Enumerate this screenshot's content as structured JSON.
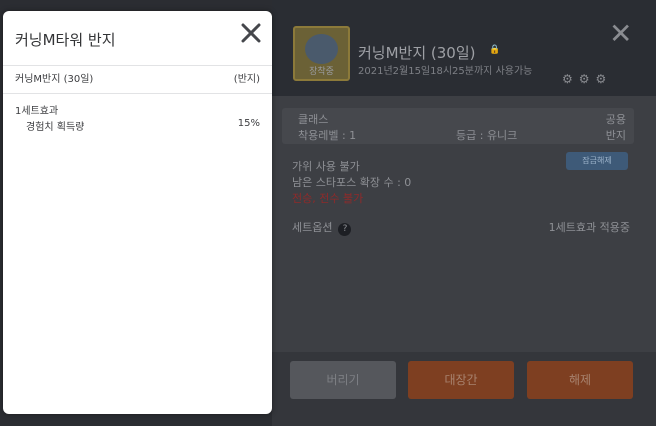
{
  "modal": {
    "title": "커닝M타워 반지",
    "item_name": "커닝M반지 (30일)",
    "item_type": "(반지)",
    "set_label": "1세트효과",
    "stat_name": "경험치 획득량",
    "stat_value": "15%"
  },
  "detail": {
    "thumb_badge": "장착중",
    "title": "커닝M반지 (30일)",
    "lock_icon": "lock-icon",
    "expiry": "2021년2월15일18시25분까지 사용가능",
    "class_label": "클래스",
    "class_value": "공용",
    "req_level": "착용레벨 : 1",
    "grade": "등급 : 유니크",
    "slot": "반지",
    "scissors": "가위 사용 불가",
    "starforce": "남은 스타포스 확장 수 : 0",
    "restriction": "전승, 전수 불가",
    "unlock_button": "잠금해제",
    "set_option": "세트옵션",
    "set_applied": "1세트효과 적용중"
  },
  "footer": {
    "discard": "버리기",
    "storage": "대장간",
    "unequip": "해제"
  },
  "colors": {
    "accent_orange": "#7e3f21",
    "restriction_red": "#8f2a2a",
    "tab_purple": "#5b3fa8"
  }
}
